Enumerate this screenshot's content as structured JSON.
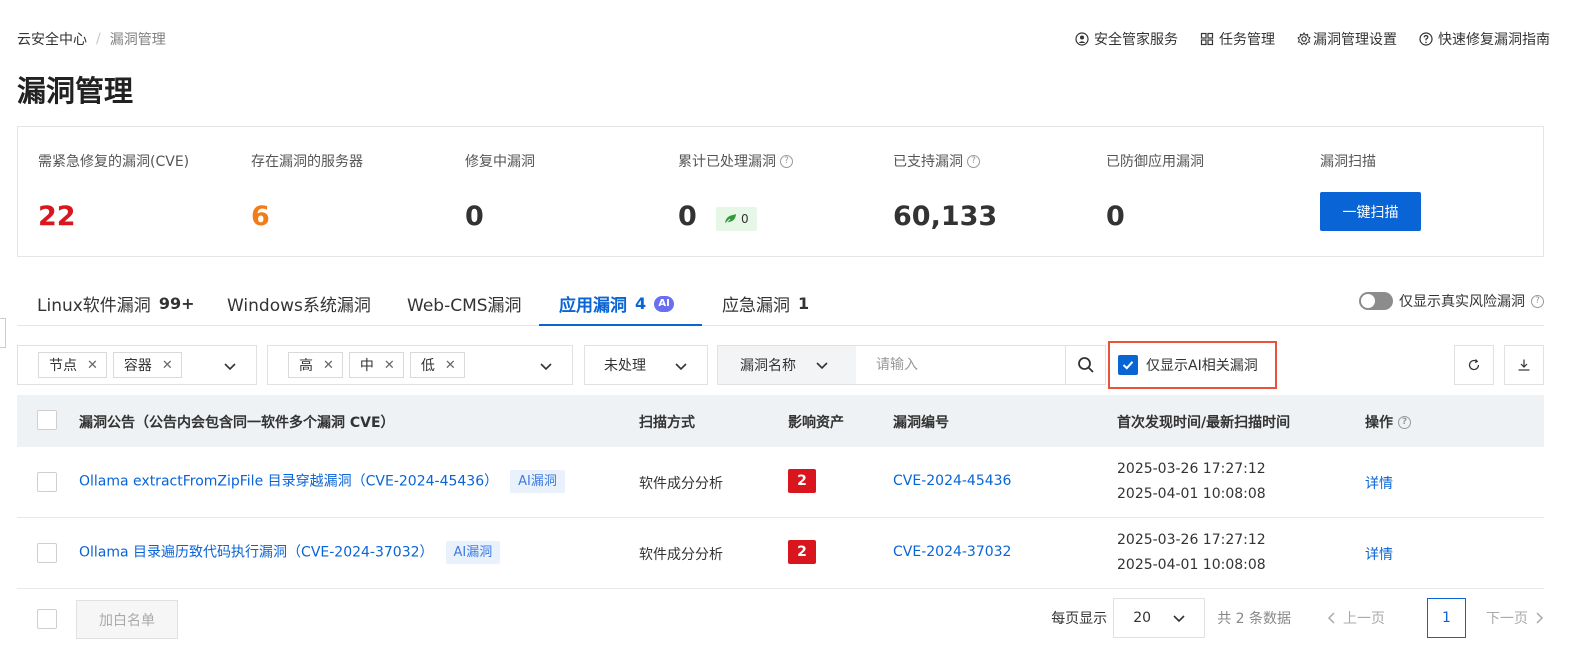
{
  "breadcrumb": {
    "root": "云安全中心",
    "sep": "/",
    "current": "漏洞管理"
  },
  "toplinks": [
    {
      "label": "安全管家服务",
      "icon": "user-shield-icon"
    },
    {
      "label": "任务管理",
      "icon": "grid-icon"
    },
    {
      "label": "漏洞管理设置",
      "icon": "gear-icon"
    },
    {
      "label": "快速修复漏洞指南",
      "icon": "question-icon"
    }
  ],
  "page_title": "漏洞管理",
  "stats": [
    {
      "label": "需紧急修复的漏洞(CVE)",
      "value": "22",
      "color": "#d9151e"
    },
    {
      "label": "存在漏洞的服务器",
      "value": "6",
      "color": "#f07d18"
    },
    {
      "label": "修复中漏洞",
      "value": "0",
      "color": "#333333"
    },
    {
      "label": "累计已处理漏洞",
      "value": "0",
      "chip": "0",
      "help": "?"
    },
    {
      "label": "已支持漏洞",
      "value": "60,133",
      "help": "?"
    },
    {
      "label": "已防御应用漏洞",
      "value": "0"
    },
    {
      "label": "漏洞扫描",
      "button": "一键扫描"
    }
  ],
  "tabs": [
    {
      "label": "Linux软件漏洞",
      "count": "99+"
    },
    {
      "label": "Windows系统漏洞",
      "count": ""
    },
    {
      "label": "Web-CMS漏洞",
      "count": ""
    },
    {
      "label": "应用漏洞",
      "count": "4",
      "badge": "AI",
      "active": true
    },
    {
      "label": "应急漏洞",
      "count": "1"
    }
  ],
  "toggle_label": "仅显示真实风险漏洞",
  "filters": {
    "node_tags": [
      "节点",
      "容器"
    ],
    "level_tags": [
      "高",
      "中",
      "低"
    ],
    "status": "未处理",
    "search_field": "漏洞名称",
    "search_placeholder": "请输入",
    "ai_only_label": "仅显示AI相关漏洞",
    "ai_only_checked": true
  },
  "table": {
    "headers": {
      "notice": "漏洞公告（公告内会包含同一软件多个漏洞 CVE）",
      "scan": "扫描方式",
      "assets": "影响资产",
      "id": "漏洞编号",
      "time": "首次发现时间/最新扫描时间",
      "action": "操作"
    },
    "rows": [
      {
        "title": "Ollama extractFromZipFile 目录穿越漏洞（CVE-2024-45436）",
        "tag": "AI漏洞",
        "scan": "软件成分分析",
        "assets": "2",
        "cve": "CVE-2024-45436",
        "first": "2025-03-26 17:27:12",
        "last": "2025-04-01 10:08:08",
        "action": "详情"
      },
      {
        "title": "Ollama 目录遍历致代码执行漏洞（CVE-2024-37032）",
        "tag": "AI漏洞",
        "scan": "软件成分分析",
        "assets": "2",
        "cve": "CVE-2024-37032",
        "first": "2025-03-26 17:27:12",
        "last": "2025-04-01 10:08:08",
        "action": "详情"
      }
    ]
  },
  "footer": {
    "whitelist": "加白名单",
    "per_page_label": "每页显示",
    "per_page": "20",
    "total": "共 2 条数据",
    "prev": "上一页",
    "page": "1",
    "next": "下一页"
  },
  "colors": {
    "accent": "#0964d6",
    "danger": "#d9151e",
    "warn": "#f07d18",
    "highlight": "#e8533a"
  }
}
